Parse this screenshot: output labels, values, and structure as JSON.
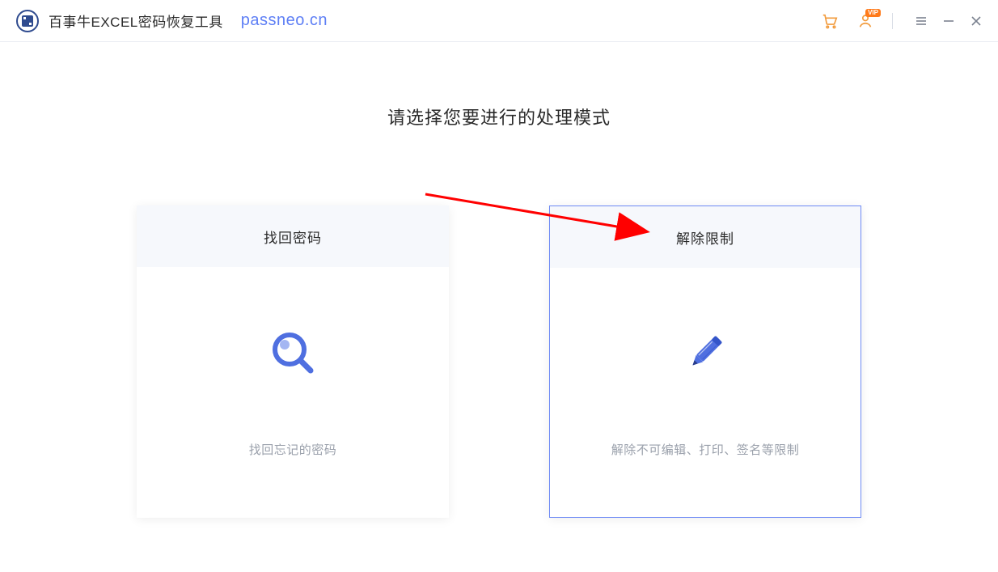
{
  "header": {
    "app_title": "百事牛EXCEL密码恢复工具",
    "brand_link": "passneo.cn",
    "icons": {
      "cart": "cart-icon",
      "user": "user-icon",
      "vip_badge": "VIP",
      "menu": "menu-icon",
      "minimize": "minimize-icon",
      "close": "close-icon"
    }
  },
  "main": {
    "heading": "请选择您要进行的处理模式",
    "cards": [
      {
        "id": "recover-password",
        "title": "找回密码",
        "icon": "magnifier-icon",
        "description": "找回忘记的密码",
        "selected": false
      },
      {
        "id": "remove-restriction",
        "title": "解除限制",
        "icon": "pencil-icon",
        "description": "解除不可编辑、打印、签名等限制",
        "selected": true
      }
    ]
  },
  "annotation": {
    "arrow": "red-arrow pointing to 解除限制 card"
  }
}
